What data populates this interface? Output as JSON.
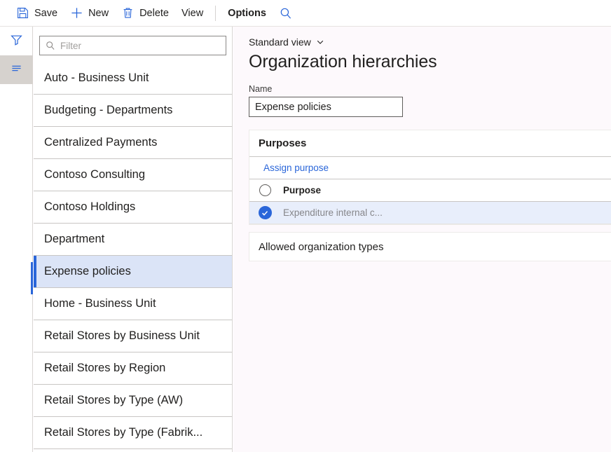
{
  "toolbar": {
    "items": [
      {
        "label": "Save",
        "icon": "save-icon",
        "active": false
      },
      {
        "label": "New",
        "icon": "plus-icon",
        "active": false
      },
      {
        "label": "Delete",
        "icon": "trash-icon",
        "active": false
      },
      {
        "label": "View",
        "icon": "",
        "active": false
      },
      {
        "label": "Options",
        "icon": "",
        "active": true
      }
    ],
    "search_icon": "search-icon"
  },
  "rail": {
    "filter_icon": "filter-funnel-icon",
    "list_icon": "list-lines-icon"
  },
  "list_pane": {
    "filter": {
      "placeholder": "Filter",
      "value": "",
      "icon": "search-icon"
    },
    "items": [
      {
        "label": "Auto - Business Unit",
        "selected": false
      },
      {
        "label": "Budgeting - Departments",
        "selected": false
      },
      {
        "label": "Centralized Payments",
        "selected": false
      },
      {
        "label": "Contoso Consulting",
        "selected": false
      },
      {
        "label": "Contoso Holdings",
        "selected": false
      },
      {
        "label": "Department",
        "selected": false
      },
      {
        "label": "Expense policies",
        "selected": true
      },
      {
        "label": "Home - Business Unit",
        "selected": false
      },
      {
        "label": "Retail Stores by Business Unit",
        "selected": false
      },
      {
        "label": "Retail Stores by Region",
        "selected": false
      },
      {
        "label": "Retail Stores by Type (AW)",
        "selected": false
      },
      {
        "label": "Retail Stores by Type (Fabrik...",
        "selected": false
      }
    ]
  },
  "content": {
    "view_selector": {
      "label": "Standard view",
      "icon": "chevron-down-icon"
    },
    "page_title": "Organization hierarchies",
    "name_field": {
      "label": "Name",
      "value": "Expense policies"
    },
    "purposes": {
      "heading": "Purposes",
      "assign_link": "Assign purpose",
      "columns": [
        "Purpose"
      ],
      "rows": [
        {
          "text": "Expenditure internal c...",
          "checked": true,
          "selected": true
        }
      ]
    },
    "allowed_org_types": {
      "heading": "Allowed organization types"
    }
  },
  "colors": {
    "accent": "#2a66d9",
    "selected_list_bg": "#dbe4f7",
    "selected_row_bg": "#e8eefb",
    "rail_selected_bg": "#d6d2ce",
    "text": "#201f1e",
    "muted_text": "#86868a",
    "page_bg": "#fdf9fc"
  }
}
